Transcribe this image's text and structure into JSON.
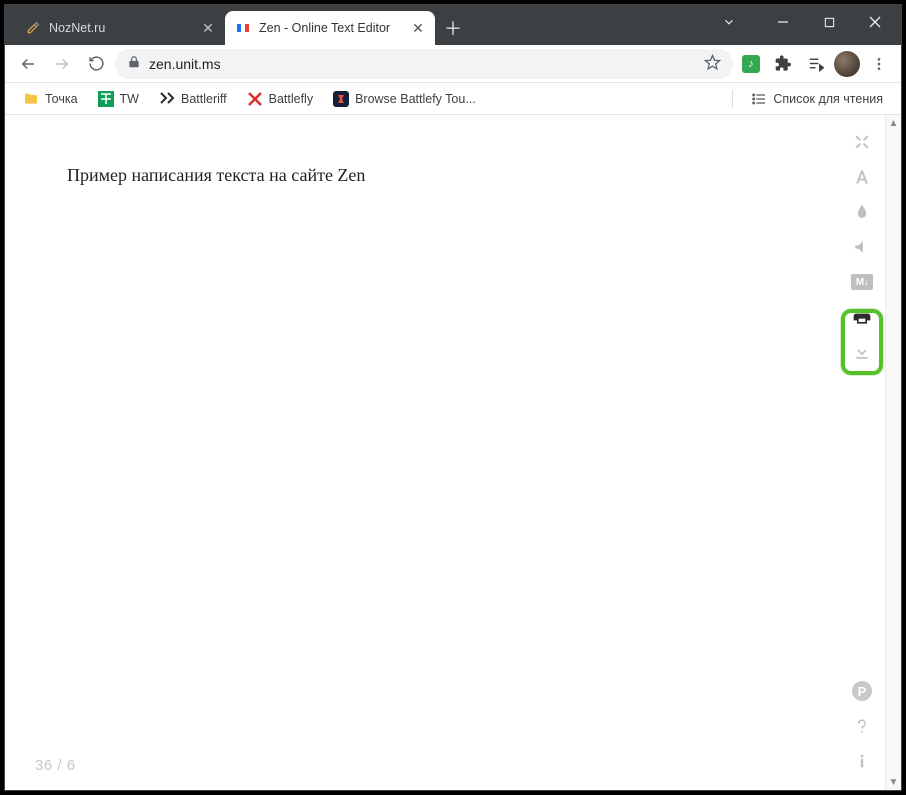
{
  "window": {
    "tabs": [
      {
        "title": "NozNet.ru",
        "active": false
      },
      {
        "title": "Zen - Online Text Editor",
        "active": true
      }
    ]
  },
  "address": {
    "url": "zen.unit.ms"
  },
  "bookmarks": {
    "items": [
      {
        "label": "Точка",
        "icon": "folder"
      },
      {
        "label": "TW",
        "icon": "tw"
      },
      {
        "label": "Battleriff",
        "icon": "battleriff"
      },
      {
        "label": "Battlefly",
        "icon": "battlefly"
      },
      {
        "label": "Browse Battlefy Tou...",
        "icon": "battlefy"
      }
    ],
    "reading_list": "Список для чтения"
  },
  "editor": {
    "text": "Пример написания текста на сайте Zen",
    "char_count": "36",
    "word_count": "6",
    "sep": "  /  "
  },
  "side_tools": {
    "md_label": "M↓"
  }
}
